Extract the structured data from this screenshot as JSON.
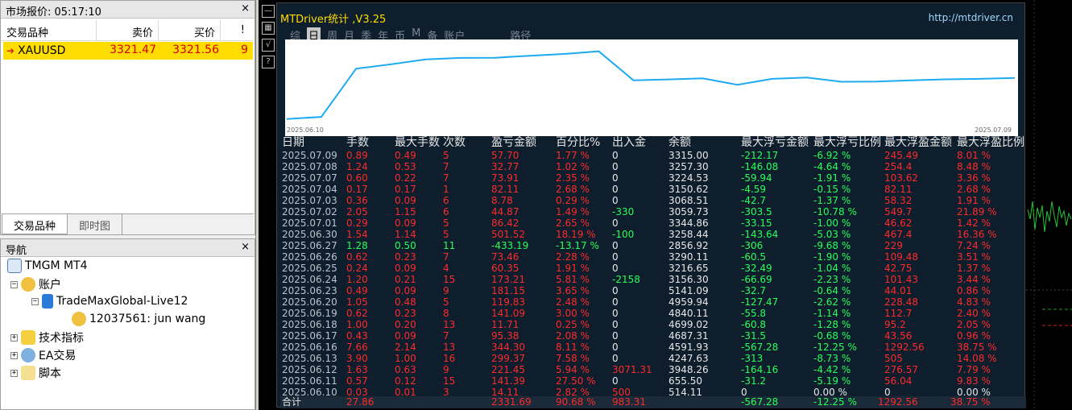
{
  "market_watch": {
    "title": "市场报价: 05:17:10",
    "close": "×",
    "columns": [
      "交易品种",
      "卖价",
      "买价",
      "!"
    ],
    "row": {
      "symbol": "XAUUSD",
      "bid": "3321.47",
      "ask": "3321.56",
      "spread": "9"
    },
    "tabs": [
      "交易品种",
      "即时图"
    ]
  },
  "navigator": {
    "title": "导航",
    "close": "×",
    "root": "TMGM MT4",
    "accounts": "账户",
    "server": "TradeMaxGlobal-Live12",
    "account": "12037561: jun wang",
    "indicators": "技术指标",
    "experts": "EA交易",
    "scripts": "脚本"
  },
  "stats": {
    "title": "MTDriver统计 ,V3.25",
    "url": "http://mtdriver.cn",
    "tabs": [
      "综",
      "日",
      "周",
      "月",
      "季",
      "年",
      "币",
      "M",
      "备",
      "账户",
      "",
      "路径"
    ],
    "spark_start": "2025.06.10",
    "spark_end": "2025.07.09",
    "headers": [
      "日期",
      "手数",
      "最大手数",
      "次数",
      "盈亏金额",
      "百分比%",
      "出入金",
      "余额",
      "最大浮亏金额",
      "最大浮亏比例",
      "最大浮盈金额",
      "最大浮盈比例"
    ],
    "rows": [
      [
        "2025.07.09",
        "0.89",
        "0.49",
        "5",
        "57.70",
        "1.77 %",
        "0",
        "3315.00",
        "-212.17",
        "-6.92 %",
        "245.49",
        "8.01 %"
      ],
      [
        "2025.07.08",
        "1.24",
        "0.53",
        "7",
        "32.77",
        "1.02 %",
        "0",
        "3257.30",
        "-146.08",
        "-4.64 %",
        "254.4",
        "8.48 %"
      ],
      [
        "2025.07.07",
        "0.60",
        "0.22",
        "7",
        "73.91",
        "2.35 %",
        "0",
        "3224.53",
        "-59.94",
        "-1.91 %",
        "103.62",
        "3.36 %"
      ],
      [
        "2025.07.04",
        "0.17",
        "0.17",
        "1",
        "82.11",
        "2.68 %",
        "0",
        "3150.62",
        "-4.59",
        "-0.15 %",
        "82.11",
        "2.68 %"
      ],
      [
        "2025.07.03",
        "0.36",
        "0.09",
        "6",
        "8.78",
        "0.29 %",
        "0",
        "3068.51",
        "-42.7",
        "-1.37 %",
        "58.32",
        "1.91 %"
      ],
      [
        "2025.07.02",
        "2.05",
        "1.15",
        "6",
        "44.87",
        "1.49 %",
        "-330",
        "3059.73",
        "-303.5",
        "-10.78 %",
        "549.7",
        "21.89 %"
      ],
      [
        "2025.07.01",
        "0.29",
        "0.09",
        "5",
        "86.42",
        "2.65 %",
        "0",
        "3344.86",
        "-33.15",
        "-1.00 %",
        "46.62",
        "1.42 %"
      ],
      [
        "2025.06.30",
        "1.54",
        "1.14",
        "5",
        "501.52",
        "18.19 %",
        "-100",
        "3258.44",
        "-143.64",
        "-5.03 %",
        "467.4",
        "16.36 %"
      ],
      [
        "2025.06.27",
        "1.28",
        "0.50",
        "11",
        "-433.19",
        "-13.17 %",
        "0",
        "2856.92",
        "-306",
        "-9.68 %",
        "229",
        "7.24 %"
      ],
      [
        "2025.06.26",
        "0.62",
        "0.23",
        "7",
        "73.46",
        "2.28 %",
        "0",
        "3290.11",
        "-60.5",
        "-1.90 %",
        "109.48",
        "3.51 %"
      ],
      [
        "2025.06.25",
        "0.24",
        "0.09",
        "4",
        "60.35",
        "1.91 %",
        "0",
        "3216.65",
        "-32.49",
        "-1.04 %",
        "42.75",
        "1.37 %"
      ],
      [
        "2025.06.24",
        "1.20",
        "0.21",
        "15",
        "173.21",
        "5.81 %",
        "-2158",
        "3156.30",
        "-66.69",
        "-2.23 %",
        "101.43",
        "3.44 %"
      ],
      [
        "2025.06.23",
        "0.49",
        "0.09",
        "9",
        "181.15",
        "3.65 %",
        "0",
        "5141.09",
        "-32.7",
        "-0.64 %",
        "44.01",
        "0.86 %"
      ],
      [
        "2025.06.20",
        "1.05",
        "0.48",
        "5",
        "119.83",
        "2.48 %",
        "0",
        "4959.94",
        "-127.47",
        "-2.62 %",
        "228.48",
        "4.83 %"
      ],
      [
        "2025.06.19",
        "0.62",
        "0.23",
        "8",
        "141.09",
        "3.00 %",
        "0",
        "4840.11",
        "-55.8",
        "-1.14 %",
        "112.7",
        "2.40 %"
      ],
      [
        "2025.06.18",
        "1.00",
        "0.20",
        "13",
        "11.71",
        "0.25 %",
        "0",
        "4699.02",
        "-60.8",
        "-1.28 %",
        "95.2",
        "2.05 %"
      ],
      [
        "2025.06.17",
        "0.43",
        "0.09",
        "7",
        "95.38",
        "2.08 %",
        "0",
        "4687.31",
        "-31.5",
        "-0.68 %",
        "43.56",
        "0.96 %"
      ],
      [
        "2025.06.16",
        "7.66",
        "2.14",
        "13",
        "344.30",
        "8.11 %",
        "0",
        "4591.93",
        "-567.28",
        "-12.25 %",
        "1292.56",
        "38.75 %"
      ],
      [
        "2025.06.13",
        "3.90",
        "1.00",
        "16",
        "299.37",
        "7.58 %",
        "0",
        "4247.63",
        "-313",
        "-8.73 %",
        "505",
        "14.08 %"
      ],
      [
        "2025.06.12",
        "1.63",
        "0.63",
        "9",
        "221.45",
        "5.94 %",
        "3071.31",
        "3948.26",
        "-164.16",
        "-4.42 %",
        "276.57",
        "7.79 %"
      ],
      [
        "2025.06.11",
        "0.57",
        "0.12",
        "15",
        "141.39",
        "27.50 %",
        "0",
        "655.50",
        "-31.2",
        "-5.19 %",
        "56.04",
        "9.83 %"
      ],
      [
        "2025.06.10",
        "0.03",
        "0.01",
        "3",
        "14.11",
        "2.82 %",
        "500",
        "514.11",
        "0",
        "0.00 %",
        "0",
        "0.00 %"
      ]
    ],
    "total": {
      "label": "合计",
      "lots": "27.86",
      "pnl": "2331.69",
      "pct": "90.68 %",
      "deposit": "983.31",
      "max_dd": "-567.28",
      "max_dd_pct": "-12.25 %",
      "max_fp": "1292.56",
      "max_fp_pct": "38.75 %"
    }
  },
  "colors": {
    "profit": "#ff2b2b",
    "loss": "#29ff5a",
    "line": "#1eaaf1",
    "highlight": "#ffdd00"
  }
}
